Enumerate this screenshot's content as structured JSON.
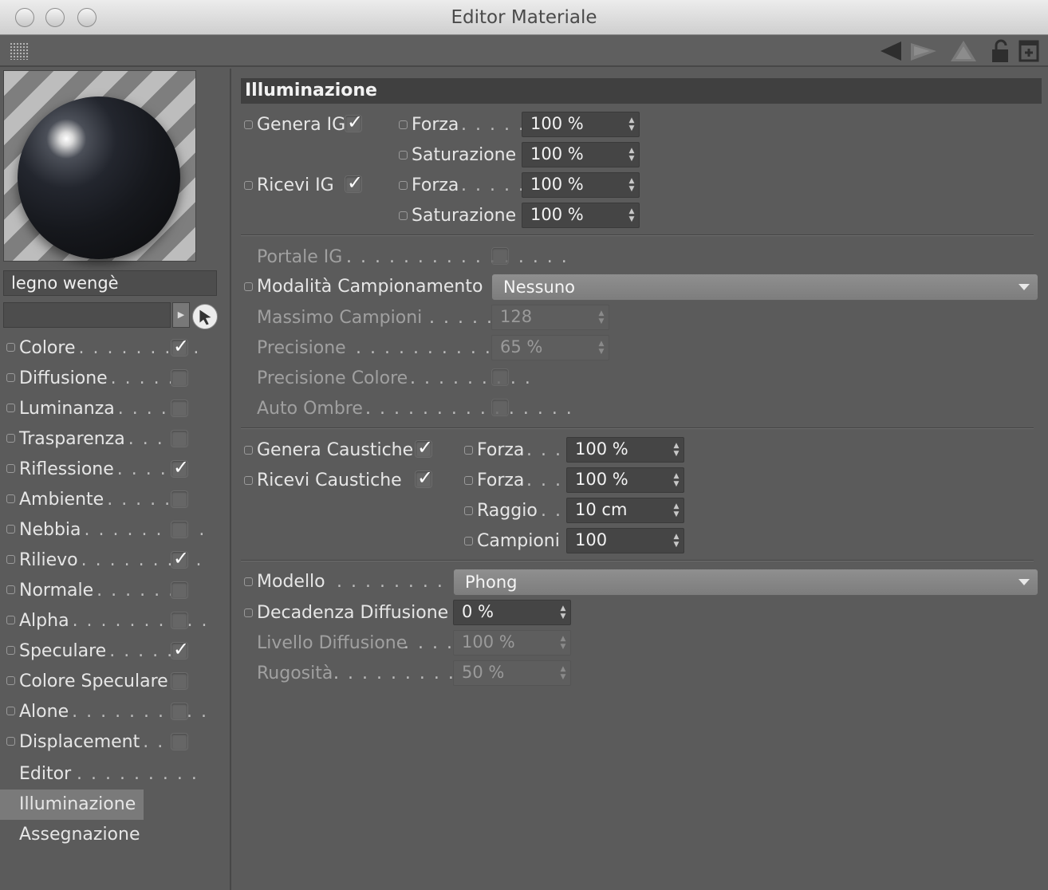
{
  "window": {
    "title": "Editor Materiale"
  },
  "toolbar": {
    "icons": [
      "grip-icon",
      "back-arrow-icon",
      "forward-arrow-icon",
      "up-arrow-icon",
      "lock-icon",
      "new-window-icon"
    ]
  },
  "material": {
    "name": "legno wengè",
    "search_value": ""
  },
  "channels": [
    {
      "label": "Colore",
      "checked": true
    },
    {
      "label": "Diffusione",
      "checked": false
    },
    {
      "label": "Luminanza",
      "checked": false
    },
    {
      "label": "Trasparenza",
      "checked": false
    },
    {
      "label": "Riflessione",
      "checked": true
    },
    {
      "label": "Ambiente",
      "checked": false
    },
    {
      "label": "Nebbia",
      "checked": false
    },
    {
      "label": "Rilievo",
      "checked": true
    },
    {
      "label": "Normale",
      "checked": false
    },
    {
      "label": "Alpha",
      "checked": false
    },
    {
      "label": "Speculare",
      "checked": true
    },
    {
      "label": "Colore Speculare",
      "checked": false
    },
    {
      "label": "Alone",
      "checked": false
    },
    {
      "label": "Displacement",
      "checked": false
    }
  ],
  "nav": [
    {
      "label": "Editor"
    },
    {
      "label": "Illuminazione",
      "selected": true
    },
    {
      "label": "Assegnazione"
    }
  ],
  "section": {
    "title": "Illuminazione"
  },
  "gi": {
    "genera_label": "Genera IG",
    "genera_checked": true,
    "ricevi_label": "Ricevi IG",
    "ricevi_checked": true,
    "forza_label": "Forza",
    "saturazione_label": "Saturazione",
    "genera_forza": "100 %",
    "genera_saturazione": "100 %",
    "ricevi_forza": "100 %",
    "ricevi_saturazione": "100 %"
  },
  "sampling": {
    "portale_label": "Portale IG",
    "modalita_label": "Modalità Campionamento",
    "modalita_value": "Nessuno",
    "massimo_label": "Massimo Campioni",
    "massimo_value": "128",
    "precisione_label": "Precisione",
    "precisione_value": "65 %",
    "precisione_colore_label": "Precisione Colore",
    "auto_ombre_label": "Auto Ombre"
  },
  "caustics": {
    "genera_label": "Genera Caustiche",
    "genera_checked": true,
    "ricevi_label": "Ricevi Caustiche",
    "ricevi_checked": true,
    "forza_label": "Forza",
    "genera_forza": "100 %",
    "ricevi_forza": "100 %",
    "raggio_label": "Raggio",
    "raggio_value": "10 cm",
    "campioni_label": "Campioni",
    "campioni_value": "100"
  },
  "model": {
    "modello_label": "Modello",
    "modello_value": "Phong",
    "decadenza_label": "Decadenza Diffusione",
    "decadenza_value": "0 %",
    "livello_label": "Livello Diffusione",
    "livello_value": "100 %",
    "rugosita_label": "Rugosità",
    "rugosita_value": "50 %"
  }
}
